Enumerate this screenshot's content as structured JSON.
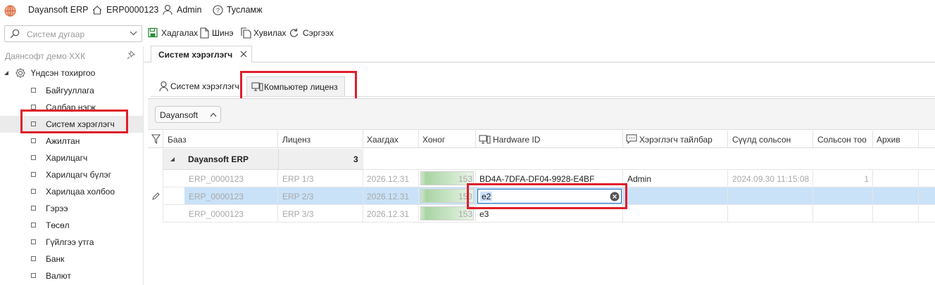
{
  "app": {
    "name": "Dayansoft ERP",
    "db_code": "ERP0000123",
    "user": "Admin",
    "help": "Тусламж"
  },
  "toolbar": {
    "search_placeholder": "Систем дугаар",
    "save": "Хадгалах",
    "new": "Шинэ",
    "copy": "Хувилах",
    "refresh": "Сэргээх"
  },
  "sidebar": {
    "company": "Даянсофт демо ХХК",
    "root": "Үндсэн тохиргоо",
    "items": [
      {
        "label": "Байгууллага"
      },
      {
        "label": "Салбар нэгж"
      },
      {
        "label": "Систем хэрэглэгч"
      },
      {
        "label": "Ажилтан"
      },
      {
        "label": "Харилцагч"
      },
      {
        "label": "Харилцагч бүлэг"
      },
      {
        "label": "Харилцаа холбоо"
      },
      {
        "label": "Гэрээ"
      },
      {
        "label": "Төсөл"
      },
      {
        "label": "Гүйлгээ утга"
      },
      {
        "label": "Банк"
      },
      {
        "label": "Валют"
      }
    ]
  },
  "doc_tab": {
    "label": "Систем хэрэглэгч"
  },
  "subtabs": [
    {
      "label": "Систем хэрэглэгч"
    },
    {
      "label": "Компьютер лиценз"
    }
  ],
  "grid": {
    "group_chip": "Dayansoft",
    "columns": [
      "Бааз",
      "Лиценз",
      "Хаагдах",
      "Хоног",
      "Hardware ID",
      "Хэрэглэгч тайлбар",
      "Сүүлд сольсон",
      "Сольсон тоо",
      "Архив"
    ],
    "group": {
      "name": "Dayansoft ERP",
      "count": "3"
    },
    "rows": [
      {
        "base": "ERP_0000123",
        "license": "ERP 1/3",
        "closes": "2026.12.31",
        "days": 153,
        "hardware_id": "BD4A-7DFA-DF04-9928-E4BF",
        "user_note": "Admin",
        "last_changed": "2024.09.30 11:15:08",
        "change_count": "1",
        "archive": ""
      },
      {
        "base": "ERP_0000123",
        "license": "ERP 2/3",
        "closes": "2026.12.31",
        "days": 153,
        "hardware_id": "e2",
        "user_note": "",
        "last_changed": "",
        "change_count": "",
        "archive": ""
      },
      {
        "base": "ERP_0000123",
        "license": "ERP 3/3",
        "closes": "2026.12.31",
        "days": 153,
        "hardware_id": "e3",
        "user_note": "",
        "last_changed": "",
        "change_count": "",
        "archive": ""
      }
    ]
  },
  "colors": {
    "accent_red": "#e01e2a",
    "selected_row": "#c9e2f8"
  }
}
